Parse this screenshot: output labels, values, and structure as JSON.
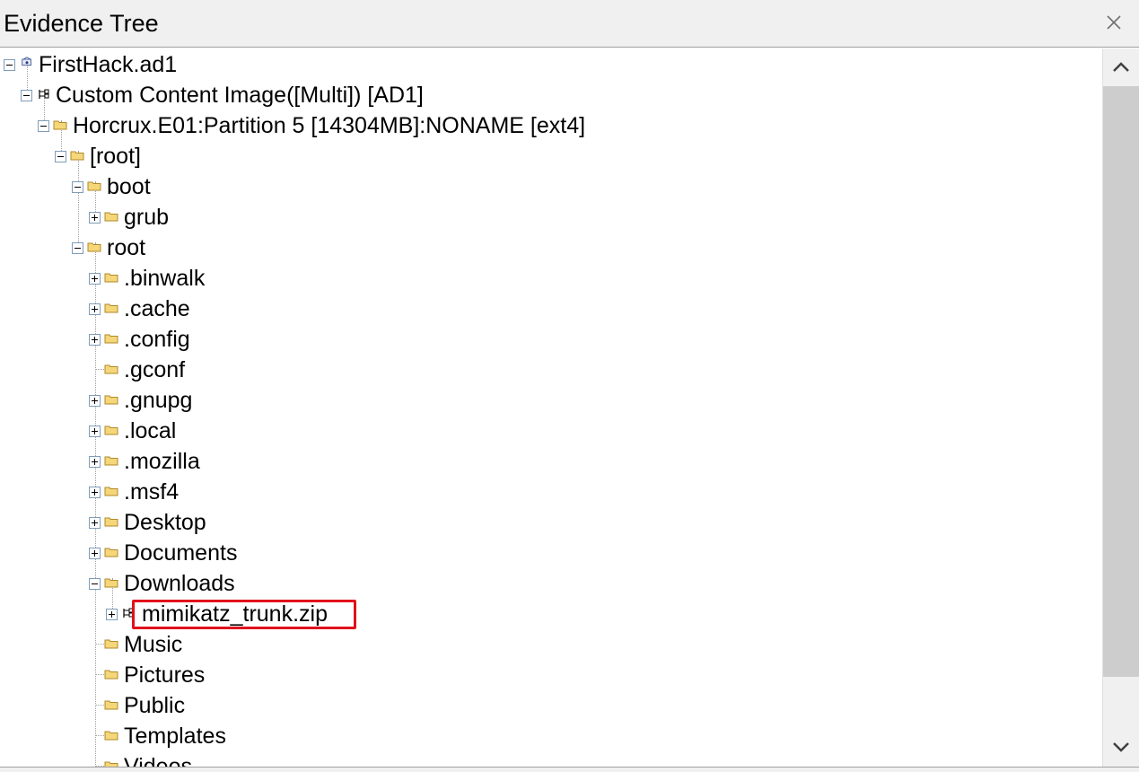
{
  "window": {
    "title": "Evidence Tree",
    "close_icon": "close-icon"
  },
  "tree": {
    "nodes": [
      {
        "label": "FirstHack.ad1",
        "toggle": "minus",
        "icon": "evidence-icon"
      },
      {
        "label": "Custom Content Image([Multi]) [AD1]",
        "toggle": "minus",
        "icon": "image-tree-icon"
      },
      {
        "label": "Horcrux.E01:Partition 5 [14304MB]:NONAME [ext4]",
        "toggle": "minus",
        "icon": "folder-icon"
      },
      {
        "label": "[root]",
        "toggle": "minus",
        "icon": "folder-icon"
      },
      {
        "label": "boot",
        "toggle": "minus",
        "icon": "folder-icon"
      },
      {
        "label": "grub",
        "toggle": "plus",
        "icon": "folder-icon"
      },
      {
        "label": "root",
        "toggle": "minus",
        "icon": "folder-icon"
      },
      {
        "label": ".binwalk",
        "toggle": "plus",
        "icon": "folder-icon"
      },
      {
        "label": ".cache",
        "toggle": "plus",
        "icon": "folder-icon"
      },
      {
        "label": ".config",
        "toggle": "plus",
        "icon": "folder-icon"
      },
      {
        "label": ".gconf",
        "toggle": "none",
        "icon": "folder-icon"
      },
      {
        "label": ".gnupg",
        "toggle": "plus",
        "icon": "folder-icon"
      },
      {
        "label": ".local",
        "toggle": "plus",
        "icon": "folder-icon"
      },
      {
        "label": ".mozilla",
        "toggle": "plus",
        "icon": "folder-icon"
      },
      {
        "label": ".msf4",
        "toggle": "plus",
        "icon": "folder-icon"
      },
      {
        "label": "Desktop",
        "toggle": "plus",
        "icon": "folder-icon"
      },
      {
        "label": "Documents",
        "toggle": "plus",
        "icon": "folder-icon"
      },
      {
        "label": "Downloads",
        "toggle": "minus",
        "icon": "folder-icon"
      },
      {
        "label": "mimikatz_trunk.zip",
        "toggle": "plus",
        "icon": "image-tree-icon",
        "highlighted": true
      },
      {
        "label": "Music",
        "toggle": "none",
        "icon": "folder-icon"
      },
      {
        "label": "Pictures",
        "toggle": "none",
        "icon": "folder-icon"
      },
      {
        "label": "Public",
        "toggle": "none",
        "icon": "folder-icon"
      },
      {
        "label": "Templates",
        "toggle": "none",
        "icon": "folder-icon"
      },
      {
        "label": "Videos",
        "toggle": "none",
        "icon": "folder-icon"
      }
    ]
  },
  "scrollbar": {
    "up_icon": "chevron-up-icon",
    "down_icon": "chevron-down-icon"
  },
  "colors": {
    "highlight_border": "#e0111b",
    "folder_fill": "#f5d77a",
    "folder_stroke": "#b08a2a",
    "titlebar_bg": "#f0f0f0",
    "scroll_thumb": "#cdcdcd"
  }
}
